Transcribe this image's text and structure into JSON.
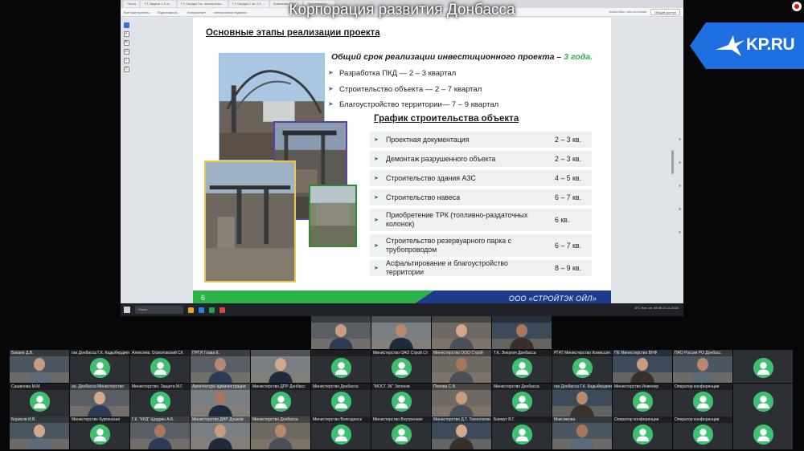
{
  "caption": "Корпорация развития Донбасса",
  "brand": {
    "logo_text": "KP.RU",
    "accent": "#1f6fe0"
  },
  "browser": {
    "tabs": [
      "Почта",
      "Т.1 Задачи 1-й эт…",
      "Т.1 Сводка Гос. экспертиза…",
      "Т.1 Сводка 1 кв. 2.К …",
      "Компания АО «…",
      "Презентация …"
    ],
    "bookmarks": [
      "Все мои проекты",
      "Подготовка в...",
      "Консультант",
      "электронные подписи"
    ],
    "right_text": "Найти бюл. или источник",
    "button": "Общий доступ"
  },
  "slide": {
    "title": "Основные этапы реализации проекта",
    "lead": "Общий срок реализации инвестиционного проекта –",
    "lead_highlight": "3 года.",
    "phases": [
      "Разработка ПКД — 2 – 3 квартал",
      "Строительство объекта — 2 – 7 квартал",
      "Благоустройство территории— 7 – 9 квартал"
    ],
    "schedule_title": "График строительства объекта",
    "schedule": [
      {
        "name": "Проектная документация",
        "term": "2 – 3 кв."
      },
      {
        "name": "Демонтаж разрушенного объекта",
        "term": "2 – 3 кв."
      },
      {
        "name": "Строительство здания АЗС",
        "term": "4 – 5 кв."
      },
      {
        "name": "Строительство навеса",
        "term": "6 – 7 кв."
      },
      {
        "name": "Приобретение ТРК (топливно-раздаточных колонок)",
        "term": "6 кв."
      },
      {
        "name": "Строительство резервуарного парка с трубопроводом",
        "term": "6 – 7 кв."
      },
      {
        "name": "Асфальтирование и благоустройство территории",
        "term": "8 – 9 кв."
      }
    ],
    "page_number": "6",
    "company": "ООО «СТРОЙТЭК ОЙЛ»"
  },
  "taskbar": {
    "search": "Поиск",
    "tray": "8°С Исп. сп. 08:50 21.11.2024"
  },
  "participants": {
    "row0": [
      "",
      "",
      "",
      ""
    ],
    "row1": [
      "Бакаев Д.В.",
      "ган Донбасса Г.К. Кадыбердиева",
      "Алексеев. Осмоловский СК",
      "ПРГИ Глава Е.",
      "",
      "",
      "Министерство ОАО Строй Ст",
      "Министерство ООО Строй",
      "Т.К. Энергия Донбасса",
      "РГАТ Министерство Комиссия",
      "ПЕ Министерство ВНФ",
      "ПАО Россия РО Донбасс"
    ],
    "row2": [
      "Сашинова М.М.",
      "ан. Донбасса Министерство",
      "Министерство. Защита М.Г.",
      "Архитектура администрация",
      "Министерство ДПР Донбасс",
      "Министерство Донбасса",
      "\"МОСТ ЗК\" Затонов",
      "Попова С.В.",
      "Министерство Донбасса",
      "ган Донбасса Г.К. Кадыбердиева",
      "Министерство Инженер",
      "Оператор конференции"
    ],
    "row3": [
      "Борисов И.В.",
      "Министерство Курганская",
      "Г.К. \"КРД\" Щедрин А.Б.",
      "Министерство ДНР Душков",
      "Министерство Донбасса",
      "Министерство Волгодонск",
      "Министерство Внутренних",
      "Министерство Д.Т. Технологии",
      "Бахмут В.Г.",
      "Максимова",
      "Оператор конференции",
      "Оператор конференции"
    ]
  },
  "colors": {
    "avatar": "#3fbf6f",
    "tile": "#2c2f33",
    "slide_green": "#2db24a",
    "slide_navy": "#1e3a8a"
  }
}
